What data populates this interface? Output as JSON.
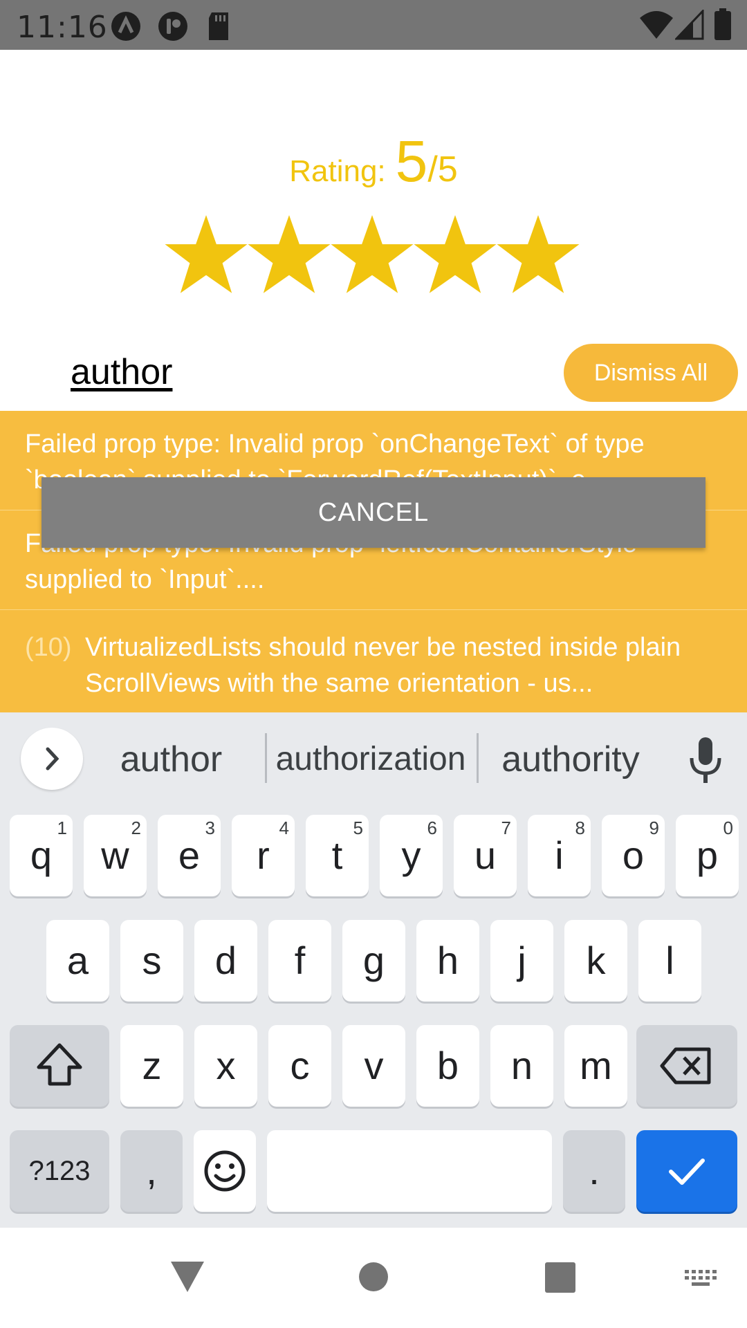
{
  "status_bar": {
    "time": "11:16",
    "left_icons": [
      "app-a-icon",
      "app-circle-icon",
      "sd-card-icon"
    ],
    "right_icons": [
      "wifi-icon",
      "signal-icon",
      "battery-icon"
    ]
  },
  "rating": {
    "label": "Rating:",
    "value": "5",
    "denominator": "/5",
    "stars_filled": 5,
    "stars_total": 5,
    "star_color": "#f1c40f"
  },
  "author_input": {
    "value": "author"
  },
  "dismiss_button": {
    "label": "Dismiss All",
    "color": "#f6b93b"
  },
  "logs": [
    {
      "text": "Failed prop type: Invalid prop `onChangeText` of type `boolean` supplied to `ForwardRef(TextInput)`, e..."
    },
    {
      "text": "Failed prop type: Invalid prop `leftIconContainerStyle` supplied to `Input`...."
    },
    {
      "count": "(10)",
      "text": "VirtualizedLists should never be nested inside plain ScrollViews with the same orientation - us..."
    }
  ],
  "cancel_button": {
    "label": "CANCEL"
  },
  "keyboard": {
    "suggestions": [
      "author",
      "authorization",
      "authority"
    ],
    "row1": [
      {
        "k": "q",
        "h": "1"
      },
      {
        "k": "w",
        "h": "2"
      },
      {
        "k": "e",
        "h": "3"
      },
      {
        "k": "r",
        "h": "4"
      },
      {
        "k": "t",
        "h": "5"
      },
      {
        "k": "y",
        "h": "6"
      },
      {
        "k": "u",
        "h": "7"
      },
      {
        "k": "i",
        "h": "8"
      },
      {
        "k": "o",
        "h": "9"
      },
      {
        "k": "p",
        "h": "0"
      }
    ],
    "row2": [
      "a",
      "s",
      "d",
      "f",
      "g",
      "h",
      "j",
      "k",
      "l"
    ],
    "row3": [
      "z",
      "x",
      "c",
      "v",
      "b",
      "n",
      "m"
    ],
    "symbols_label": "?123",
    "comma_label": ",",
    "period_label": ".",
    "enter_color": "#1a73e8"
  },
  "nav_bar": {
    "icons": [
      "back-icon",
      "home-icon",
      "recents-icon",
      "keyboard-switch-icon"
    ]
  }
}
